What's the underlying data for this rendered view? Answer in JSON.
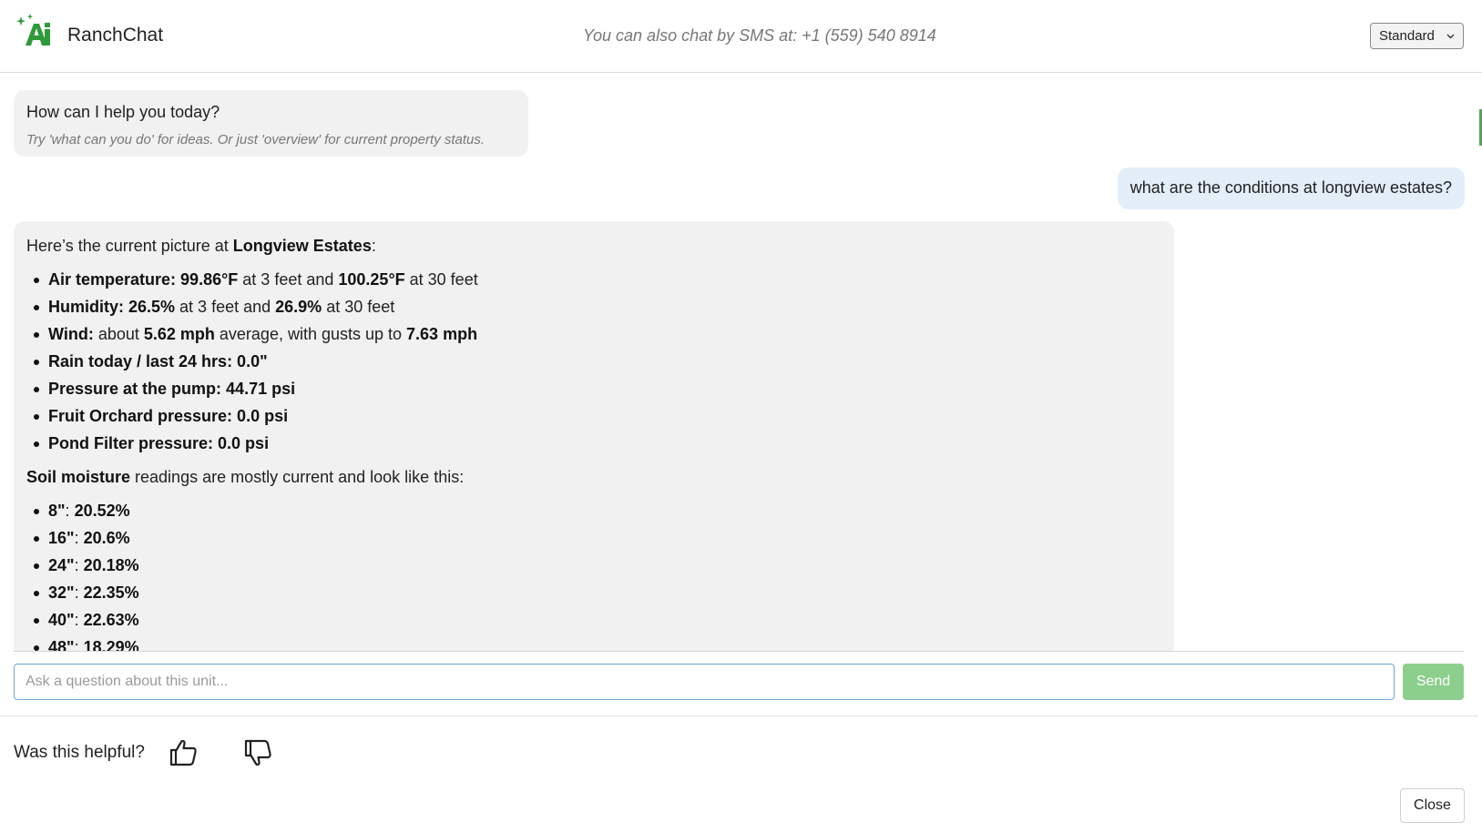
{
  "header": {
    "app_title": "RanchChat",
    "sms_note": "You can also chat by SMS at: +1 (559) 540 8914",
    "mode_select": {
      "selected": "Standard"
    },
    "brand_color": "#2e9a3a"
  },
  "greeting": {
    "main": "How can I help you today?",
    "hint": "Try 'what can you do' for ideas. Or just 'overview' for current property status."
  },
  "user_message": "what are the conditions at longview estates?",
  "answer": {
    "intro_prefix": "Here’s the current picture at ",
    "intro_place": "Longview Estates",
    "intro_suffix": ":",
    "conditions": [
      {
        "label": "Air temperature:",
        "parts": [
          {
            "t": " 99.86°F",
            "b": true
          },
          {
            "t": " at 3 feet and ",
            "b": false
          },
          {
            "t": "100.25°F",
            "b": true
          },
          {
            "t": " at 30 feet",
            "b": false
          }
        ]
      },
      {
        "label": "Humidity:",
        "parts": [
          {
            "t": " 26.5%",
            "b": true
          },
          {
            "t": " at 3 feet and ",
            "b": false
          },
          {
            "t": "26.9%",
            "b": true
          },
          {
            "t": " at 30 feet",
            "b": false
          }
        ]
      },
      {
        "label": "Wind:",
        "parts": [
          {
            "t": " about ",
            "b": false
          },
          {
            "t": "5.62 mph",
            "b": true
          },
          {
            "t": " average, with gusts up to ",
            "b": false
          },
          {
            "t": "7.63 mph",
            "b": true
          }
        ]
      },
      {
        "label": "Rain today / last 24 hrs: 0.0\"",
        "parts": []
      },
      {
        "label": "Pressure at the pump: 44.71 psi",
        "parts": []
      },
      {
        "label": "Fruit Orchard pressure: 0.0 psi",
        "parts": []
      },
      {
        "label": "Pond Filter pressure: 0.0 psi",
        "parts": []
      }
    ],
    "soil_heading_bold": "Soil moisture",
    "soil_heading_rest": " readings are mostly current and look like this:",
    "soil": [
      {
        "depth": "8\"",
        "value": "20.52%"
      },
      {
        "depth": "16\"",
        "value": "20.6%"
      },
      {
        "depth": "24\"",
        "value": "20.18%"
      },
      {
        "depth": "32\"",
        "value": "22.35%"
      },
      {
        "depth": "40\"",
        "value": "22.63%"
      },
      {
        "depth": "48\"",
        "value": "18.29%"
      }
    ]
  },
  "composer": {
    "placeholder": "Ask a question about this unit...",
    "value": "",
    "send_label": "Send"
  },
  "feedback": {
    "prompt": "Was this helpful?",
    "up_icon": "thumbs-up-icon",
    "down_icon": "thumbs-down-icon"
  },
  "close_label": "Close"
}
